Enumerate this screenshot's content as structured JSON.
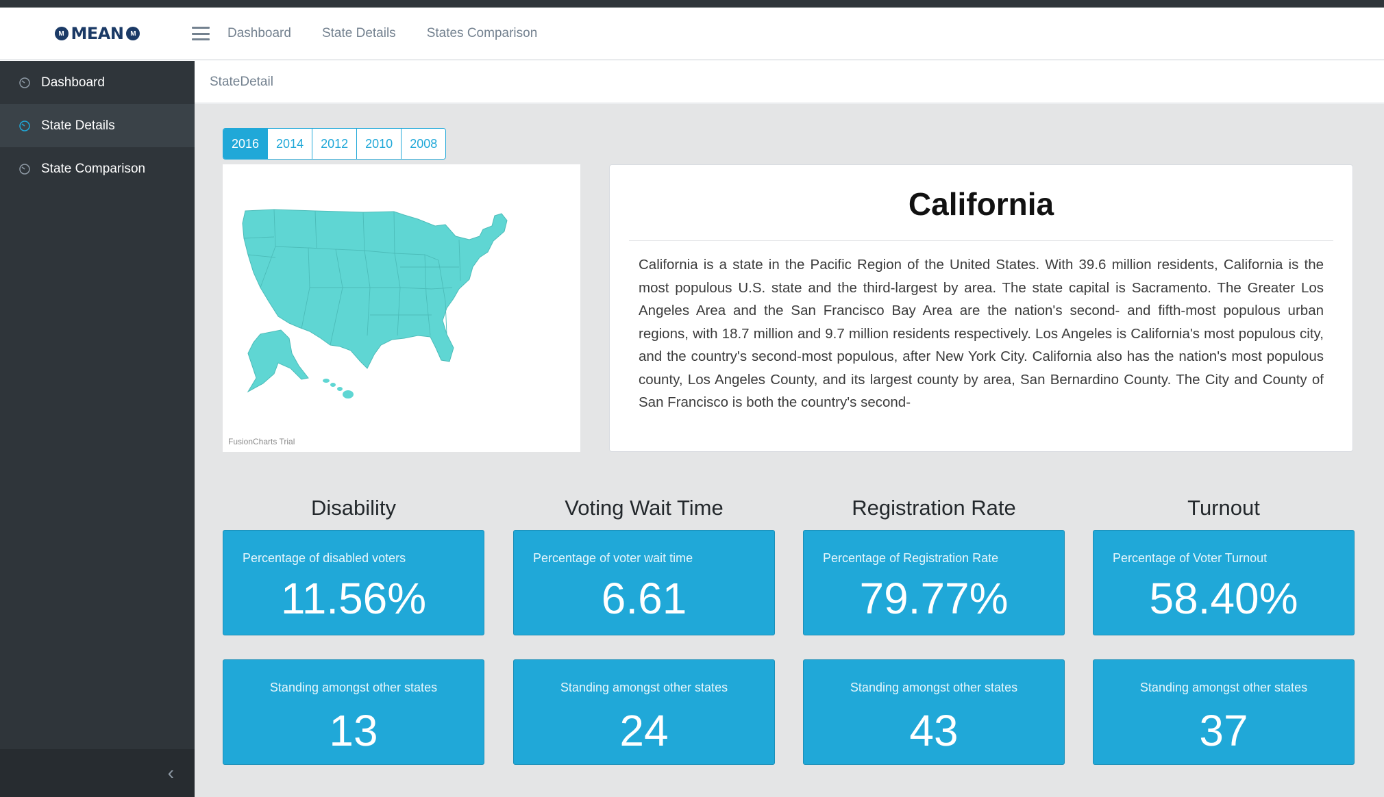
{
  "brand": {
    "name": "MEAN",
    "badge": "M"
  },
  "header": {
    "nav": [
      "Dashboard",
      "State Details",
      "States Comparison"
    ]
  },
  "sidebar": {
    "items": [
      {
        "label": "Dashboard",
        "active": false
      },
      {
        "label": "State Details",
        "active": true
      },
      {
        "label": "State Comparison",
        "active": false
      }
    ],
    "toggle": "‹"
  },
  "breadcrumb": "StateDetail",
  "years": {
    "options": [
      "2016",
      "2014",
      "2012",
      "2010",
      "2008"
    ],
    "selected": "2016"
  },
  "map": {
    "credit": "FusionCharts Trial",
    "fill_color": "#5fd6d3"
  },
  "state": {
    "name": "California",
    "description": "California is a state in the Pacific Region of the United States. With 39.6 million residents, California is the most populous U.S. state and the third-largest by area. The state capital is Sacramento. The Greater Los Angeles Area and the San Francisco Bay Area are the nation's second- and fifth-most populous urban regions, with 18.7 million and 9.7 million residents respectively. Los Angeles is California's most populous city, and the country's second-most populous, after New York City. California also has the nation's most populous county, Los Angeles County, and its largest county by area, San Bernardino County. The City and County of San Francisco is both the country's second-"
  },
  "metrics": [
    {
      "title": "Disability",
      "label": "Percentage of disabled voters",
      "value": "11.56%",
      "standing_label": "Standing amongst other states",
      "standing": "13"
    },
    {
      "title": "Voting Wait Time",
      "label": "Percentage of voter wait time",
      "value": "6.61",
      "standing_label": "Standing amongst other states",
      "standing": "24"
    },
    {
      "title": "Registration Rate",
      "label": "Percentage of Registration Rate",
      "value": "79.77%",
      "standing_label": "Standing amongst other states",
      "standing": "43"
    },
    {
      "title": "Turnout",
      "label": "Percentage of Voter Turnout",
      "value": "58.40%",
      "standing_label": "Standing amongst other states",
      "standing": "37"
    }
  ],
  "colors": {
    "accent": "#20a8d8",
    "sidebar": "#2f353a",
    "background": "#e4e5e6"
  }
}
